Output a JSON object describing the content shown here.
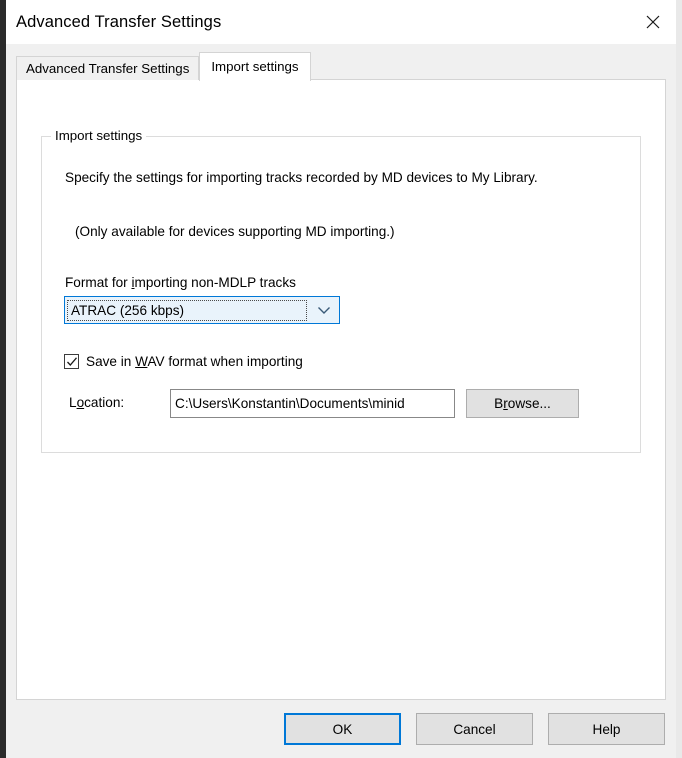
{
  "window": {
    "title": "Advanced Transfer Settings",
    "close_icon": "close-icon"
  },
  "tabs": [
    {
      "label": "Advanced Transfer Settings",
      "active": false
    },
    {
      "label": "Import settings",
      "active": true
    }
  ],
  "group": {
    "legend": "Import settings",
    "description_line1": "Specify the settings for importing tracks recorded by MD devices to My Library.",
    "description_line2": "(Only available for devices supporting MD importing.)"
  },
  "format": {
    "label_before": "Format for ",
    "label_accel": "i",
    "label_after": "mporting non-MDLP tracks",
    "label_full": "Format for importing non-MDLP tracks",
    "selected_value": "ATRAC (256 kbps)",
    "arrow_icon": "chevron-down-icon"
  },
  "save_wav": {
    "checked": true,
    "check_glyph": "✓",
    "label_before": "Save in ",
    "label_accel": "W",
    "label_after": "AV format when importing",
    "label_full": "Save in WAV format when importing"
  },
  "location": {
    "label_before": "L",
    "label_accel": "o",
    "label_after": "cation:",
    "label_full": "Location:",
    "value": "C:\\Users\\Konstantin\\Documents\\minid",
    "placeholder": ""
  },
  "browse": {
    "label_before": "B",
    "label_accel": "r",
    "label_after": "owse...",
    "label_full": "Browse..."
  },
  "footer": {
    "ok_label": "OK",
    "cancel_label": "Cancel",
    "help_label": "Help"
  },
  "colors": {
    "accent": "#0078D7",
    "dialog_bg": "#F0F0F0",
    "panel_bg": "#FFFFFF",
    "button_bg": "#E1E1E1",
    "combo_fill": "#E9F3FB"
  }
}
